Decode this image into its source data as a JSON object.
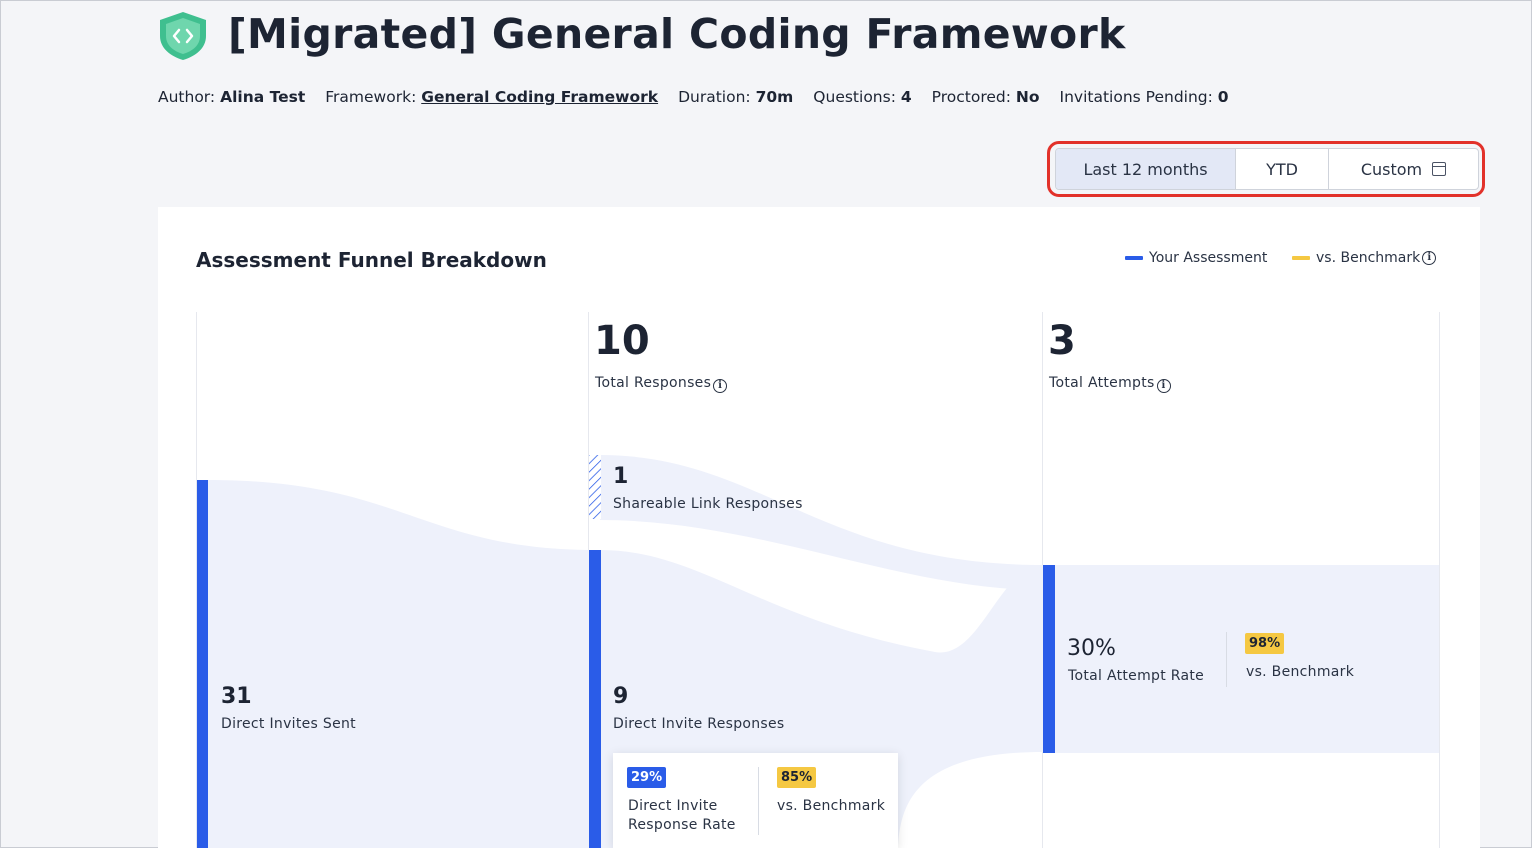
{
  "header": {
    "title": "[Migrated] General Coding Framework",
    "logo_icon": "shield-code-icon"
  },
  "meta": {
    "author_label": "Author:",
    "author_value": "Alina Test",
    "framework_label": "Framework:",
    "framework_value": "General Coding Framework",
    "duration_label": "Duration:",
    "duration_value": "70m",
    "questions_label": "Questions:",
    "questions_value": "4",
    "proctored_label": "Proctored:",
    "proctored_value": "No",
    "invitations_label": "Invitations Pending:",
    "invitations_value": "0"
  },
  "date_range": {
    "options": [
      {
        "label": "Last 12 months",
        "active": true
      },
      {
        "label": "YTD",
        "active": false
      },
      {
        "label": "Custom",
        "active": false,
        "icon": "calendar-icon"
      }
    ]
  },
  "funnel": {
    "title": "Assessment Funnel Breakdown",
    "legend": {
      "your_assessment": "Your Assessment",
      "benchmark": "vs. Benchmark"
    },
    "columns": {
      "total_responses_value": "10",
      "total_responses_label": "Total Responses",
      "total_attempts_value": "3",
      "total_attempts_label": "Total Attempts"
    },
    "direct_invites": {
      "value": "31",
      "label": "Direct Invites Sent"
    },
    "shareable": {
      "value": "1",
      "label": "Shareable Link Responses"
    },
    "direct_responses": {
      "value": "9",
      "label": "Direct Invite Responses"
    },
    "attempt_rate": {
      "value": "30%",
      "label": "Total Attempt Rate",
      "benchmark_value": "98%",
      "benchmark_label": "vs. Benchmark"
    },
    "response_rate": {
      "value": "29%",
      "label_line1": "Direct Invite",
      "label_line2": "Response Rate",
      "benchmark_value": "85%",
      "benchmark_label": "vs. Benchmark"
    },
    "colors": {
      "primary": "#2a5ce8",
      "benchmark": "#f5c842",
      "flow": "#eef1fb"
    }
  }
}
